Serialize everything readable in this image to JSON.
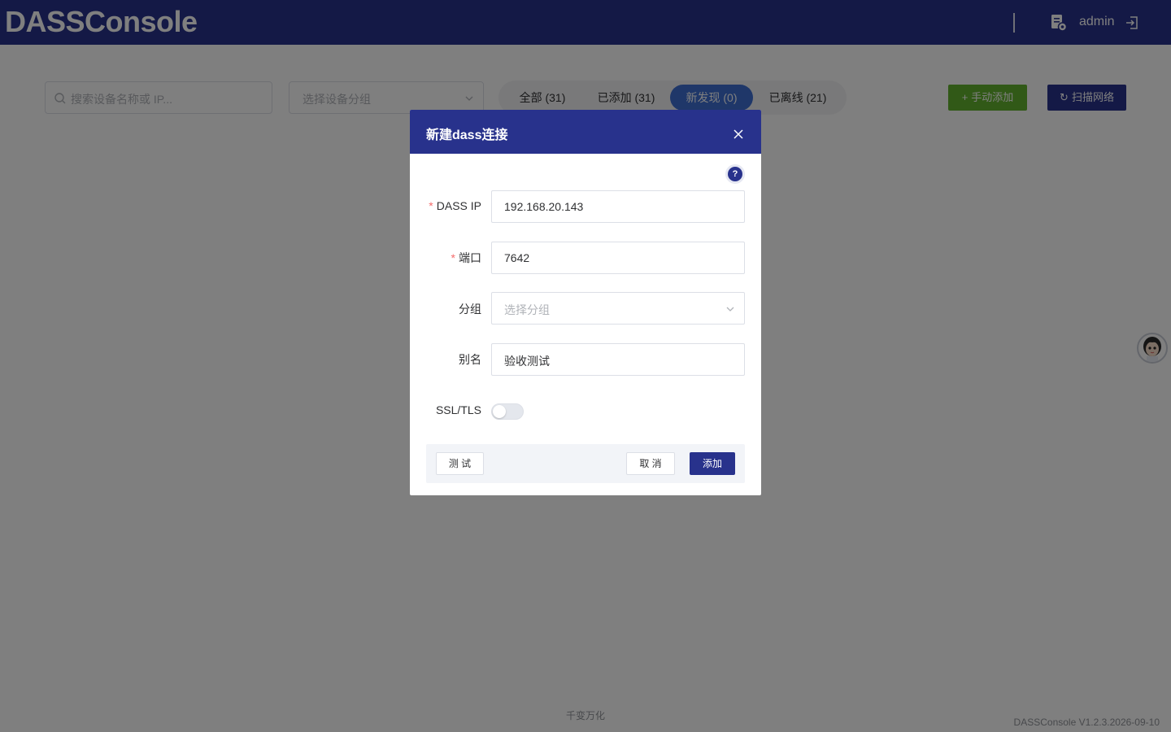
{
  "header": {
    "logo": "DASSConsole",
    "username": "admin"
  },
  "toolbar": {
    "search_placeholder": "搜索设备名称或 IP...",
    "group_placeholder": "选择设备分组",
    "tabs": [
      {
        "label": "全部 (31)",
        "active": false
      },
      {
        "label": "已添加 (31)",
        "active": false
      },
      {
        "label": "新发现 (0)",
        "active": true
      },
      {
        "label": "已离线 (21)",
        "active": false
      }
    ],
    "manual_add_label": "手动添加",
    "scan_label": "扫描网络"
  },
  "footer": {
    "center_text": "千变万化",
    "version": "DASSConsole V1.2.3.2026-09-10"
  },
  "dialog": {
    "title": "新建dass连接",
    "help_glyph": "?",
    "fields": {
      "ip": {
        "label": "DASS IP",
        "value": "192.168.20.143",
        "required": true
      },
      "port": {
        "label": "端口",
        "value": "7642",
        "required": true
      },
      "group": {
        "label": "分组",
        "placeholder": "选择分组"
      },
      "alias": {
        "label": "别名",
        "value": "验收测试"
      },
      "ssl": {
        "label": "SSL/TLS",
        "enabled": false
      }
    },
    "buttons": {
      "test": "测 试",
      "cancel": "取 消",
      "add": "添加"
    }
  },
  "colors": {
    "brand": "#28328c",
    "success": "#63b32e",
    "active_tab": "#3e6ed2"
  },
  "icons": [
    "document-settings-icon",
    "logout-icon",
    "search-icon",
    "chevron-down-icon",
    "plus-icon",
    "refresh-icon",
    "close-icon",
    "help-icon",
    "assistant-avatar-icon"
  ]
}
